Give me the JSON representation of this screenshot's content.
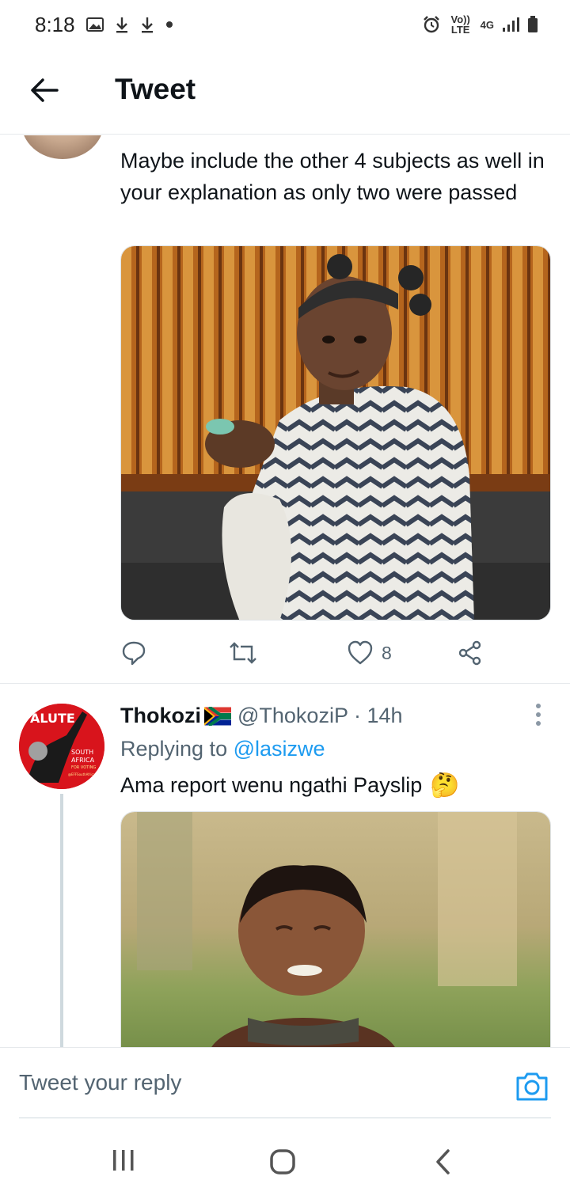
{
  "status_bar": {
    "time": "8:18",
    "left_icons": [
      "image-icon",
      "download-icon",
      "download-icon",
      "dot-icon"
    ],
    "volte_label": "Vo)) LTE",
    "network_label": "4G"
  },
  "header": {
    "title": "Tweet"
  },
  "tweet1": {
    "text": "Maybe include the other 4 subjects as well in your explanation as only two were passed",
    "like_count": "8"
  },
  "tweet2": {
    "name": "Thokozi",
    "handle": "@ThokoziP · 14h",
    "replying_prefix": "Replying to ",
    "replying_handle": "@lasizwe",
    "text": "Ama report wenu ngathi Payslip",
    "emoji": "🤔",
    "avatar_text": {
      "top": "ALUTE",
      "line1": "SOUTH",
      "line2": "AFRICA",
      "line3": "FOR VOTING",
      "line4": "@EFFSouthAfrica"
    }
  },
  "reply_bar": {
    "placeholder": "Tweet your reply"
  },
  "colors": {
    "accent": "#1d9bf0",
    "muted": "#536471",
    "text": "#0f1419",
    "divider": "#e6e9ec"
  }
}
